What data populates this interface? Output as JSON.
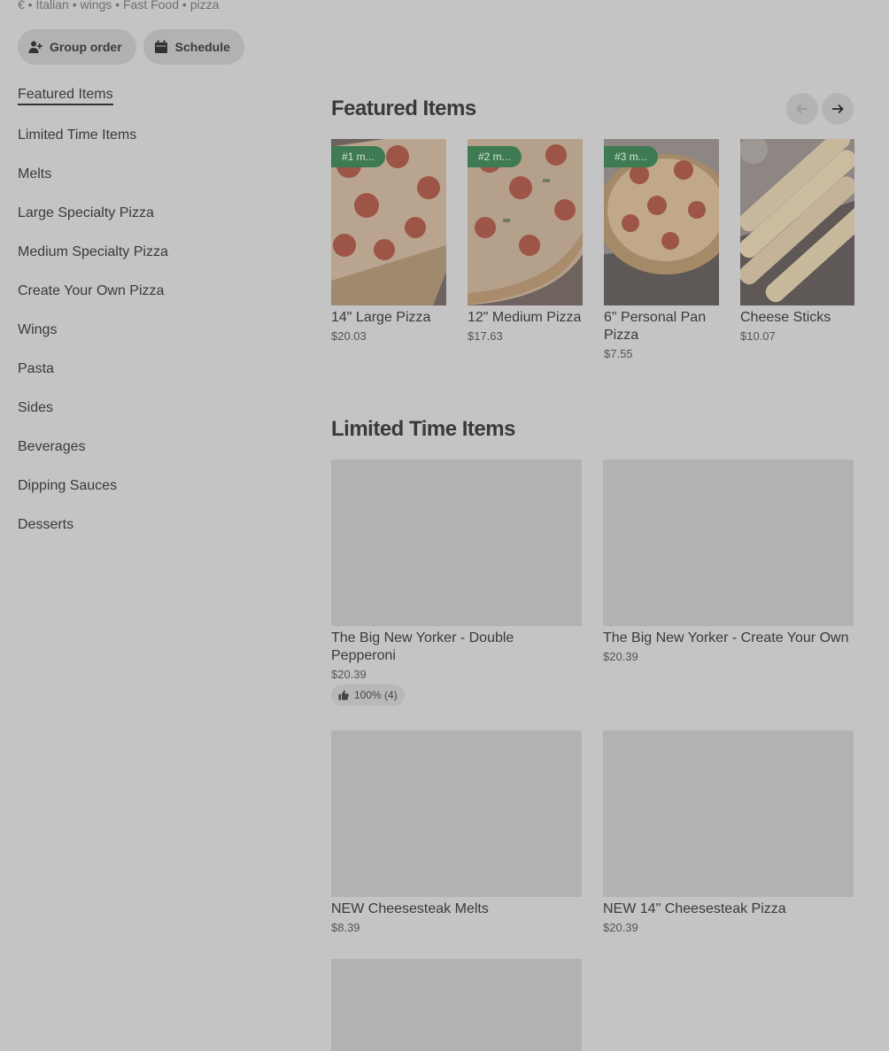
{
  "meta": {
    "text": "€ • Italian • wings • Fast Food • pizza"
  },
  "actions": {
    "group_order": "Group order",
    "schedule": "Schedule"
  },
  "nav": {
    "items": [
      "Featured Items",
      "Limited Time Items",
      "Melts",
      "Large Specialty Pizza",
      "Medium Specialty Pizza",
      "Create Your Own Pizza",
      "Wings",
      "Pasta",
      "Sides",
      "Beverages",
      "Dipping Sauces",
      "Desserts"
    ],
    "active": "Featured Items"
  },
  "featured": {
    "title": "Featured Items",
    "items": [
      {
        "badge": "#1 m...",
        "name": "14\" Large Pizza",
        "price": "$20.03"
      },
      {
        "badge": "#2 m...",
        "name": "12\" Medium Pizza",
        "price": "$17.63"
      },
      {
        "badge": "#3 m...",
        "name": "6\" Personal Pan Pizza",
        "price": "$7.55"
      },
      {
        "badge": "",
        "name": "Cheese Sticks",
        "price": "$10.07"
      }
    ]
  },
  "limited": {
    "title": "Limited Time Items",
    "items": [
      {
        "name": "The Big New Yorker - Double Pepperoni",
        "price": "$20.39",
        "rating": "100% (4)"
      },
      {
        "name": "The Big New Yorker - Create Your Own",
        "price": "$20.39"
      },
      {
        "name": "NEW Cheesesteak Melts",
        "price": "$8.39"
      },
      {
        "name": "NEW 14\" Cheesesteak Pizza",
        "price": "$20.39"
      }
    ]
  },
  "icons": {
    "group_order": "person-add-icon",
    "schedule": "calendar-icon",
    "prev": "arrow-left-icon",
    "next": "arrow-right-icon",
    "rating": "thumbs-up-icon"
  },
  "colors": {
    "badge": "#3e7a52",
    "overlay_bg": "#c4c4c4"
  }
}
